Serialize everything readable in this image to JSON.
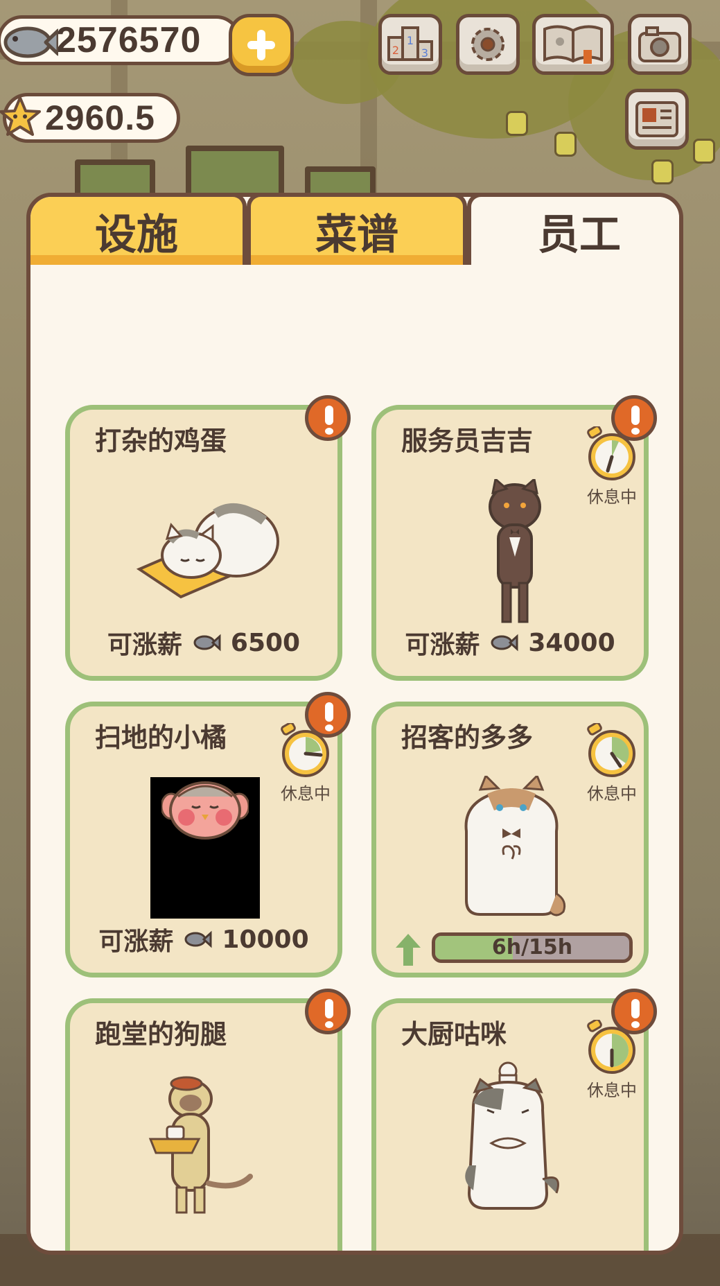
{
  "hud": {
    "fish_amount": "2576570",
    "star_amount": "2960.5"
  },
  "tabs": [
    {
      "label": "设施",
      "active": false
    },
    {
      "label": "菜谱",
      "active": false
    },
    {
      "label": "员工",
      "active": true
    }
  ],
  "staff": [
    {
      "name": "打杂的鸡蛋",
      "raise_label": "可涨薪",
      "raise_cost": "6500",
      "alert": true,
      "resting": false
    },
    {
      "name": "服务员吉吉",
      "raise_label": "可涨薪",
      "raise_cost": "34000",
      "alert": true,
      "resting": true,
      "rest_label": "休息中"
    },
    {
      "name": "扫地的小橘",
      "raise_label": "可涨薪",
      "raise_cost": "10000",
      "alert": true,
      "resting": true,
      "rest_label": "休息中"
    },
    {
      "name": "招客的多多",
      "alert": false,
      "resting": true,
      "rest_label": "休息中",
      "progress_text": "6h/15h",
      "progress_value": 0.4
    },
    {
      "name": "跑堂的狗腿",
      "alert": true,
      "resting": false
    },
    {
      "name": "大厨咕咪",
      "alert": true,
      "resting": true,
      "rest_label": "休息中"
    }
  ],
  "colors": {
    "tab_yellow": "#fbcf55",
    "panel_bg": "#fcf6ec",
    "card_bg": "#f3e5c5",
    "card_border": "#9dc079",
    "alert_orange": "#e06928",
    "outline_brown": "#6e4c3c"
  },
  "icons": [
    "fish-icon",
    "star-icon",
    "plus-icon",
    "leaderboard-icon",
    "gear-icon",
    "book-icon",
    "camera-icon",
    "newspaper-icon",
    "alert-icon",
    "stopwatch-icon",
    "up-arrow-icon"
  ]
}
